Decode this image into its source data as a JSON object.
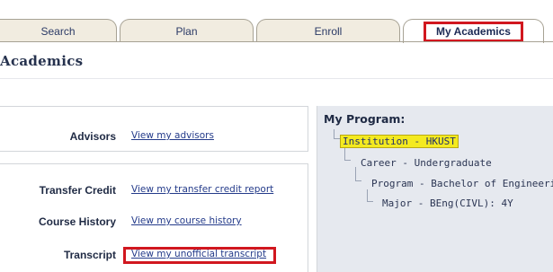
{
  "tabs": [
    {
      "label": "Search",
      "active": false
    },
    {
      "label": "Plan",
      "active": false
    },
    {
      "label": "Enroll",
      "active": false
    },
    {
      "label": "My Academics",
      "active": true
    }
  ],
  "page": {
    "title": "Academics"
  },
  "advisors": {
    "label": "Advisors",
    "link": "View my advisors"
  },
  "records": [
    {
      "label": "Transfer Credit",
      "link": "View my transfer credit report"
    },
    {
      "label": "Course History",
      "link": "View my course history"
    },
    {
      "label": "Transcript",
      "link": "View my unofficial transcript"
    }
  ],
  "program": {
    "title": "My Program:",
    "items": [
      "Institution - HKUST",
      "Career - Undergraduate",
      "Program - Bachelor of Engineering",
      "Major - BEng(CIVL): 4Y"
    ]
  },
  "colors": {
    "highlight_red": "#d1171f",
    "tree_highlight": "#f4ea1f",
    "program_bg": "#e6e9ef"
  }
}
